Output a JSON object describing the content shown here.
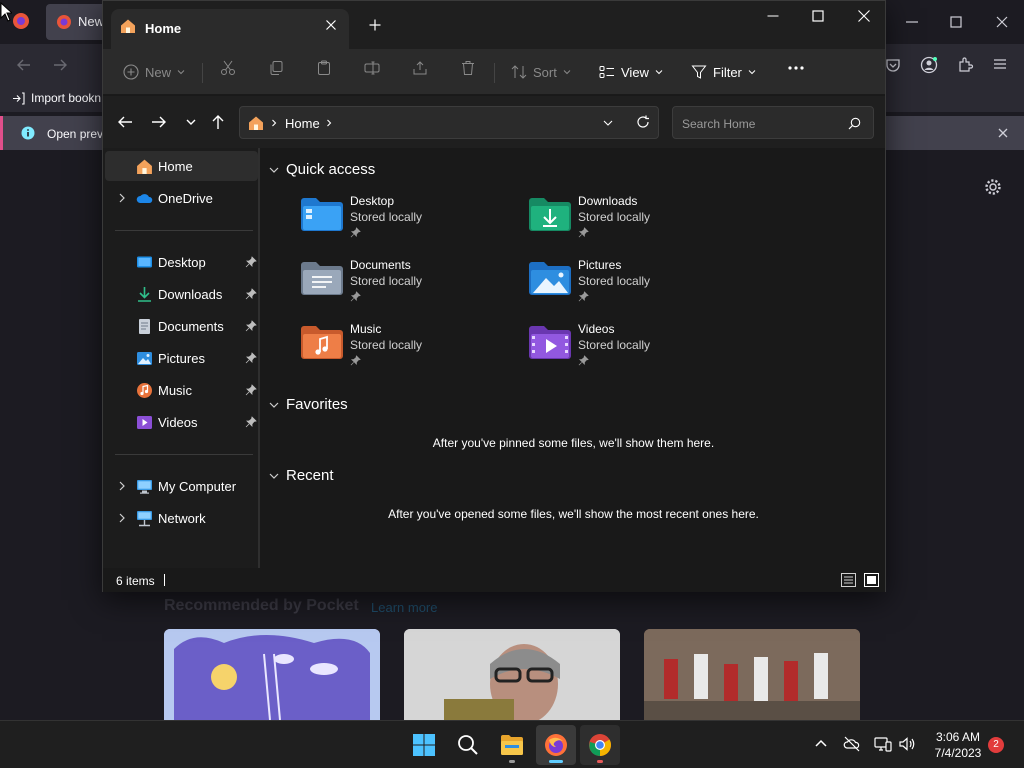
{
  "firefox": {
    "tab_title": "New",
    "bookmark_label": "Import bookn",
    "notice_text": "Open previ",
    "pocket_title": "Recommended by Pocket",
    "pocket_learn": "Learn more"
  },
  "explorer": {
    "tab_title": "Home",
    "commands": {
      "new": "New",
      "sort": "Sort",
      "view": "View",
      "filter": "Filter"
    },
    "address": {
      "breadcrumb": "Home"
    },
    "search": {
      "placeholder": "Search Home"
    },
    "nav": {
      "home": "Home",
      "onedrive": "OneDrive",
      "pinned": [
        "Desktop",
        "Downloads",
        "Documents",
        "Pictures",
        "Music",
        "Videos"
      ],
      "my_computer": "My Computer",
      "network": "Network"
    },
    "sections": {
      "quick_access": "Quick access",
      "favorites": "Favorites",
      "recent": "Recent"
    },
    "quick_access_items": [
      {
        "name": "Desktop",
        "sub": "Stored locally"
      },
      {
        "name": "Downloads",
        "sub": "Stored locally"
      },
      {
        "name": "Documents",
        "sub": "Stored locally"
      },
      {
        "name": "Pictures",
        "sub": "Stored locally"
      },
      {
        "name": "Music",
        "sub": "Stored locally"
      },
      {
        "name": "Videos",
        "sub": "Stored locally"
      }
    ],
    "favorites_empty": "After you've pinned some files, we'll show them here.",
    "recent_empty": "After you've opened some files, we'll show the most recent ones here.",
    "status": "6 items"
  },
  "taskbar": {
    "time": "3:06 AM",
    "date": "7/4/2023",
    "notifications": "2"
  },
  "colors": {
    "accent": "#60cdff",
    "desktop_folder": "#1e90e8",
    "downloads_folder": "#1fa57a",
    "documents_folder": "#7d8da3",
    "pictures_folder": "#2e8ee0",
    "music_folder": "#e8723a",
    "videos_folder": "#8b4fd6"
  }
}
